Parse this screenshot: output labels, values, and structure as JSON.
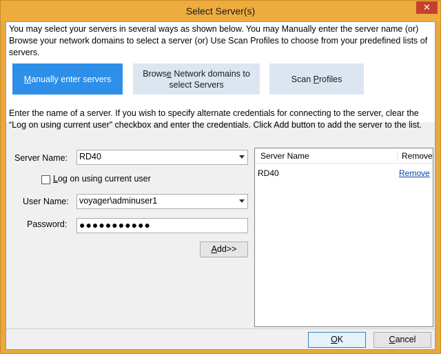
{
  "window": {
    "title": "Select Server(s)",
    "close_glyph": "✕"
  },
  "intro": "You may select your servers in several ways as shown below. You may Manually enter the server name (or) Browse your network domains to select a server (or) Use Scan Profiles to choose from your predefined lists of servers.",
  "modes": {
    "manual": {
      "pre": "",
      "key": "M",
      "post": "anually enter servers"
    },
    "browse": {
      "pre": "Brows",
      "key": "e",
      "post": " Network domains to select Servers"
    },
    "scan": {
      "pre": "Scan ",
      "key": "P",
      "post": "rofiles"
    }
  },
  "description": "Enter the name of a server. If you wish to specify alternate credentials for connecting to the server, clear the “Log on using current user” checkbox and enter the credentials. Click Add button to add the server to the list.",
  "form": {
    "server_name_label": "Server Name:",
    "server_name_value": "RD40",
    "logon_pre": "",
    "logon_key": "L",
    "logon_post": "og on using current user",
    "logon_checked": false,
    "user_name_label": "User Name:",
    "user_name_value": "voyager\\adminuser1",
    "password_label": "Password:",
    "password_value": "●●●●●●●●●●●",
    "add_pre": "",
    "add_key": "A",
    "add_post": "dd>>"
  },
  "server_list": {
    "col_name": "Server Name",
    "col_remove": "Remove",
    "rows": [
      {
        "name": "RD40",
        "action": "Remove"
      }
    ]
  },
  "footer": {
    "ok_key": "O",
    "ok_post": "K",
    "cancel_pre": "",
    "cancel_key": "C",
    "cancel_post": "ancel"
  }
}
